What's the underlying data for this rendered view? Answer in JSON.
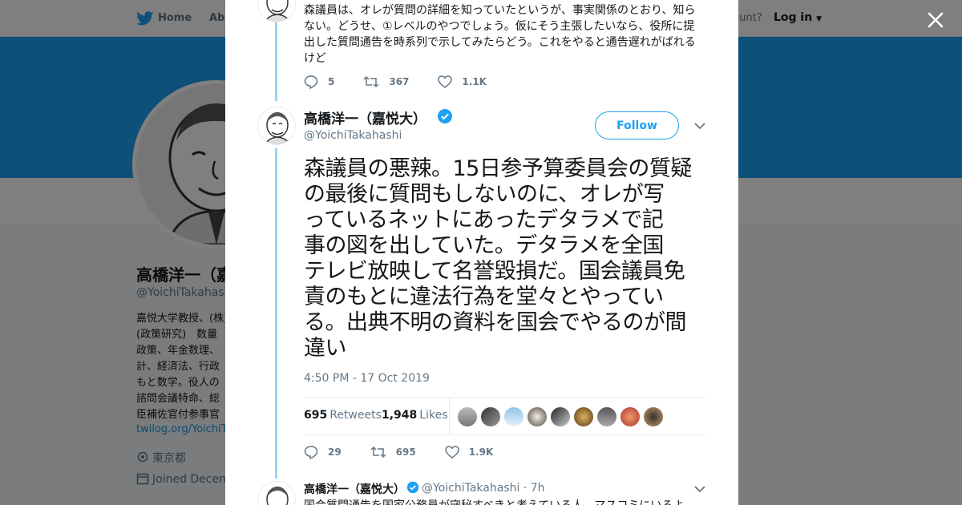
{
  "topbar": {
    "home_label": "Home",
    "about_label": "Abo",
    "account_label": "ccount?",
    "login_label": "Log in"
  },
  "profile": {
    "name": "高橋洋一（嘉",
    "handle": "@YoichiTakahashi",
    "bio_lines": [
      "嘉悦大学教授、(株)",
      "(政策研究)　数量",
      "政策、年金数理、",
      "計、経済法、行政",
      "もと数学。役人の",
      "諮問会議特命、総",
      "臣補佐官付参事官"
    ],
    "link": "twilog.org/YoichiTa",
    "location": "東京都",
    "joined": "Joined Decem"
  },
  "prev_tweet": {
    "text": "森議員は、オレが質問の詳細を知っていたというが、事実関係のとおり、知らない。どうせ、①レベルのやつでしょう。仮にそう主張したいなら、役所に提出した質問通告を時系列で示してみたらどう。これをやると通告遅れがばれるけど",
    "replies": "5",
    "retweets": "367",
    "likes": "1.1K"
  },
  "main_tweet": {
    "name": "高橋洋一（嘉悦大）",
    "handle": "@YoichiTakahashi",
    "follow_label": "Follow",
    "text_lines": [
      "森議員の悪辣。15日参予算委員会の質疑",
      "の最後に質問もしないのに、オレが写",
      "っているネットにあったデタラメで記",
      "事の図を出していた。デタラメを全国",
      "テレビ放映して名誉毀損だ。国会議員免",
      "責のもとに違法行為を堂々とやってい",
      "る。出典不明の資料を国会でやるのが間",
      "違い"
    ],
    "timestamp": "4:50 PM - 17 Oct 2019",
    "retweet_count": "695",
    "retweet_label": "Retweets",
    "like_count": "1,948",
    "like_label": "Likes",
    "replies": "29",
    "retweets": "695",
    "likes": "1.9K"
  },
  "reply_tweet": {
    "name": "高橋洋一（嘉悦大）",
    "handle": "@YoichiTakahashi · 7h",
    "text": "国会質問通告を国家公務員が守秘すべきと考えている人、マスコミにいるよ"
  },
  "colors": {
    "brand": "#1da1f2",
    "verified": "#1da1f2",
    "text": "#14171a",
    "muted": "#657786"
  }
}
